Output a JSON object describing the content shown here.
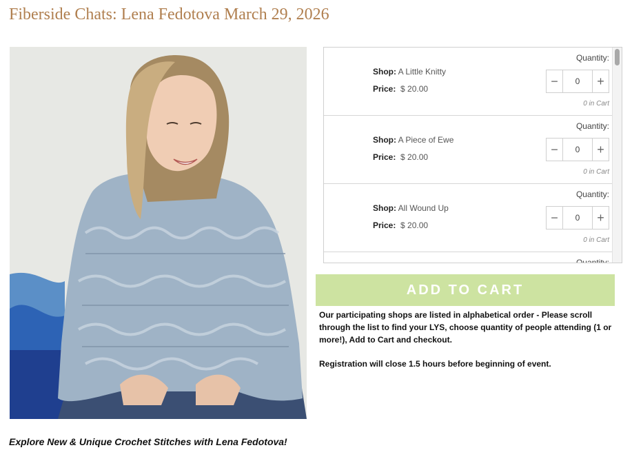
{
  "page": {
    "title": "Fiberside Chats: Lena Fedotova March 29, 2026"
  },
  "caption": "Explore New & Unique Crochet Stitches with Lena Fedotova!",
  "shops": [
    {
      "shop_label": "Shop:",
      "shop_name": "A Little Knitty",
      "price_label": "Price:",
      "price": "$ 20.00",
      "quantity_label": "Quantity:",
      "quantity": "0",
      "in_cart": "0 in Cart"
    },
    {
      "shop_label": "Shop:",
      "shop_name": "A Piece of Ewe",
      "price_label": "Price:",
      "price": "$ 20.00",
      "quantity_label": "Quantity:",
      "quantity": "0",
      "in_cart": "0 in Cart"
    },
    {
      "shop_label": "Shop:",
      "shop_name": "All Wound Up",
      "price_label": "Price:",
      "price": "$ 20.00",
      "quantity_label": "Quantity:",
      "quantity": "0",
      "in_cart": "0 in Cart"
    },
    {
      "quantity_label": "Quantity:"
    }
  ],
  "stepper": {
    "minus_icon": "minus-icon",
    "plus_icon": "plus-icon"
  },
  "add_to_cart": {
    "label": "ADD TO CART",
    "color": "#cde3a1"
  },
  "info": {
    "paragraph1": "Our participating shops are listed in alphabetical order - Please scroll through the list to find your LYS, choose quantity of people attending (1 or more!), Add to Cart and checkout.",
    "paragraph2": "Registration will close 1.5 hours before beginning of event."
  },
  "colors": {
    "title": "#b07f4f",
    "accent": "#cde3a1"
  }
}
